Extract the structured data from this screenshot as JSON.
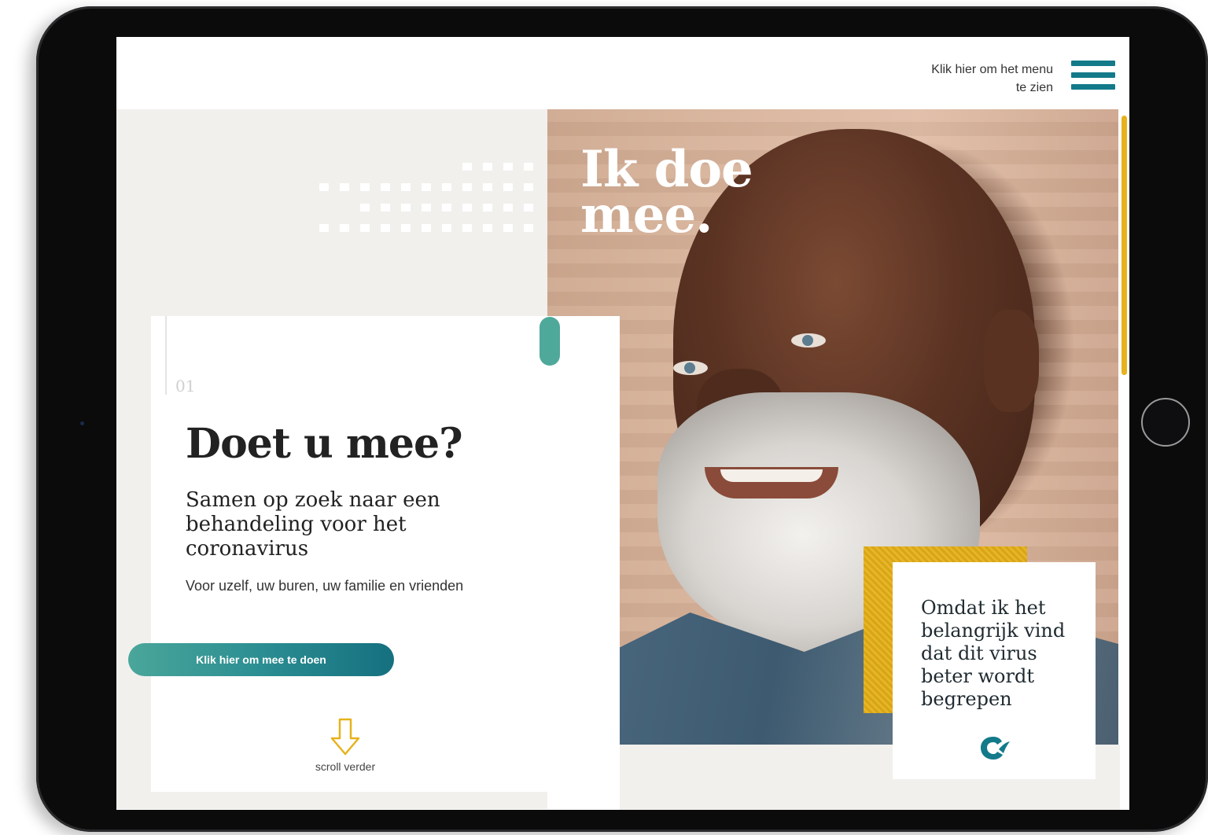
{
  "header": {
    "menu_hint_line1": "Klik hier om het menu",
    "menu_hint_line2": "te zien",
    "menu_icon": "hamburger-icon",
    "accent": "#137a8a"
  },
  "hero": {
    "headline": "Ik doe\nmee.",
    "image": "portrait-smiling-man-white-beard"
  },
  "intro": {
    "slide_number": "01",
    "title": "Doet u mee?",
    "subtitle": "Samen op zoek naar een behandeling voor het coronavirus",
    "body": "Voor uzelf, uw buren, uw familie en vrienden",
    "cta_label": "Klik hier om mee te doen",
    "scroll_label": "scroll verder",
    "scroll_icon": "arrow-down-icon"
  },
  "quote": {
    "text": "Omdat ik het belangrijk vind dat dit virus beter wordt begrepen",
    "brand_icon": "brand-logo-icon"
  },
  "colors": {
    "teal": "#4fa99b",
    "teal_dark": "#15707f",
    "gold": "#e7b21c",
    "panel_grey": "#f1f0ed"
  }
}
